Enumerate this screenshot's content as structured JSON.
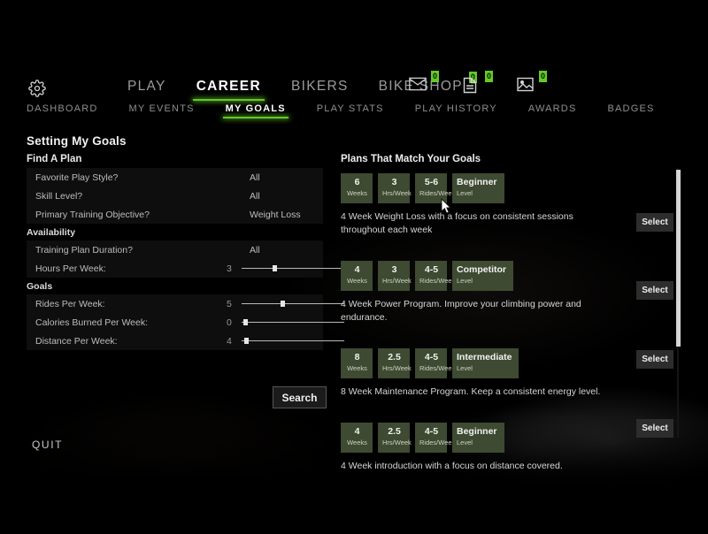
{
  "topnav": {
    "gear_icon": "gear-icon",
    "primary": [
      {
        "label": "PLAY",
        "active": false,
        "badge": null
      },
      {
        "label": "CAREER",
        "active": true,
        "badge": null
      },
      {
        "label": "BIKERS",
        "active": false,
        "badge": null
      },
      {
        "label": "BIKE SHOP",
        "active": false,
        "badge": "0"
      }
    ],
    "sub": [
      {
        "label": "DASHBOARD",
        "active": false
      },
      {
        "label": "MY EVENTS",
        "active": false
      },
      {
        "label": "MY GOALS",
        "active": true
      },
      {
        "label": "PLAY STATS",
        "active": false
      },
      {
        "label": "PLAY HISTORY",
        "active": false
      },
      {
        "label": "AWARDS",
        "active": false
      },
      {
        "label": "BADGES",
        "active": false
      }
    ],
    "icons": [
      {
        "name": "mail-icon",
        "badge": "0"
      },
      {
        "name": "document-icon",
        "badge": "0"
      },
      {
        "name": "image-icon",
        "badge": "0"
      }
    ]
  },
  "page": {
    "title": "Setting My Goals",
    "find_a_plan_label": "Find A Plan",
    "plans_title": "Plans That Match Your Goals",
    "search_label": "Search",
    "quit_label": "QUIT"
  },
  "form": {
    "sections": [
      {
        "heading": null,
        "rows": [
          {
            "label": "Favorite Play Style?",
            "value": "All",
            "type": "select"
          },
          {
            "label": "Skill Level?",
            "value": "All",
            "type": "select"
          },
          {
            "label": "Primary Training Objective?",
            "value": "Weight Loss",
            "type": "select"
          }
        ]
      },
      {
        "heading": "Availability",
        "rows": [
          {
            "label": "Training Plan Duration?",
            "value": "All",
            "type": "select"
          },
          {
            "label": "Hours Per Week:",
            "value": "3",
            "type": "slider",
            "fill": 0.3
          }
        ]
      },
      {
        "heading": "Goals",
        "rows": [
          {
            "label": "Rides Per Week:",
            "value": "5",
            "type": "slider",
            "fill": 0.38
          },
          {
            "label": "Calories Burned Per Week:",
            "value": "0",
            "type": "slider",
            "fill": 0.02
          },
          {
            "label": "Distance Per Week:",
            "value": "4",
            "type": "slider",
            "fill": 0.03
          }
        ]
      }
    ]
  },
  "plans": [
    {
      "weeks": "6",
      "weeks_unit": "Weeks",
      "hours": "3",
      "hours_unit": "Hrs/Week",
      "rides": "5-6",
      "rides_unit": "Rides/Week",
      "level": "Beginner",
      "level_unit": "Level",
      "description": "4 Week Weight Loss with a focus on consistent sessions throughout each week",
      "select_label": "Select"
    },
    {
      "weeks": "4",
      "weeks_unit": "Weeks",
      "hours": "3",
      "hours_unit": "Hrs/Week",
      "rides": "4-5",
      "rides_unit": "Rides/Week",
      "level": "Competitor",
      "level_unit": "Level",
      "description": "4 Week Power Program.  Improve your climbing power and endurance.",
      "select_label": "Select"
    },
    {
      "weeks": "8",
      "weeks_unit": "Weeks",
      "hours": "2.5",
      "hours_unit": "Hrs/Week",
      "rides": "4-5",
      "rides_unit": "Rides/Week",
      "level": "Intermediate",
      "level_unit": "Level",
      "description": "8 Week Maintenance Program.  Keep a consistent energy level.",
      "select_label": "Select"
    },
    {
      "weeks": "4",
      "weeks_unit": "Weeks",
      "hours": "2.5",
      "hours_unit": "Hrs/Week",
      "rides": "4-5",
      "rides_unit": "Rides/Week",
      "level": "Beginner",
      "level_unit": "Level",
      "description": "4 Week introduction with a focus on distance covered.",
      "select_label": "Select"
    }
  ],
  "colors": {
    "accent_green": "#63c928",
    "tile_green": "#3e4a31",
    "background": "#000000"
  }
}
